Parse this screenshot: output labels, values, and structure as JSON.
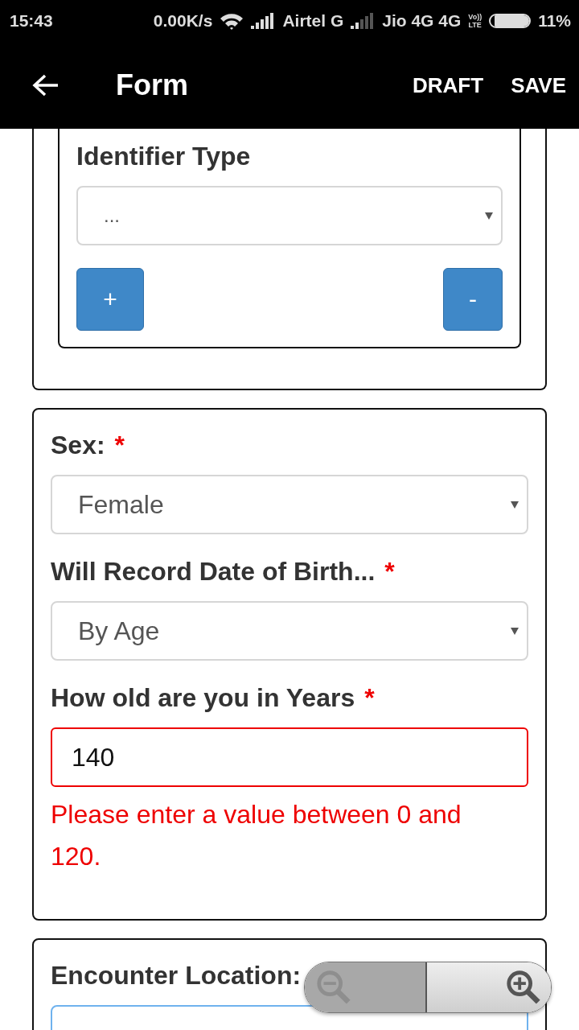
{
  "status_bar": {
    "time": "15:43",
    "speed": "0.00K/s",
    "sim1": "Airtel G",
    "sim2": "Jio 4G 4G",
    "volte": [
      "Vo))",
      "LTE"
    ],
    "battery": "11%"
  },
  "app_bar": {
    "title": "Form",
    "actions": [
      "DRAFT",
      "SAVE"
    ]
  },
  "identifier_section": {
    "label": "Identifier Type",
    "select": {
      "value": "..."
    },
    "buttons": [
      {
        "label": "+",
        "kind": "add"
      },
      {
        "label": "-",
        "kind": "remove"
      }
    ]
  },
  "patient_section": {
    "fields": [
      {
        "kind": "select",
        "label": "Sex:",
        "required_mark": "*",
        "value": "Female",
        "invalid": false
      },
      {
        "kind": "select",
        "label": "Will Record Date of Birth...",
        "required_mark": "*",
        "value": "By Age",
        "invalid": false
      },
      {
        "kind": "input",
        "label": "How old are you in Years",
        "required_mark": "*",
        "value": "140",
        "invalid": true,
        "error": "Please enter a value between 0 and 120."
      }
    ]
  },
  "location_section": {
    "label": "Encounter Location:"
  },
  "zoom_control": {
    "zoom_out_disabled": true
  }
}
